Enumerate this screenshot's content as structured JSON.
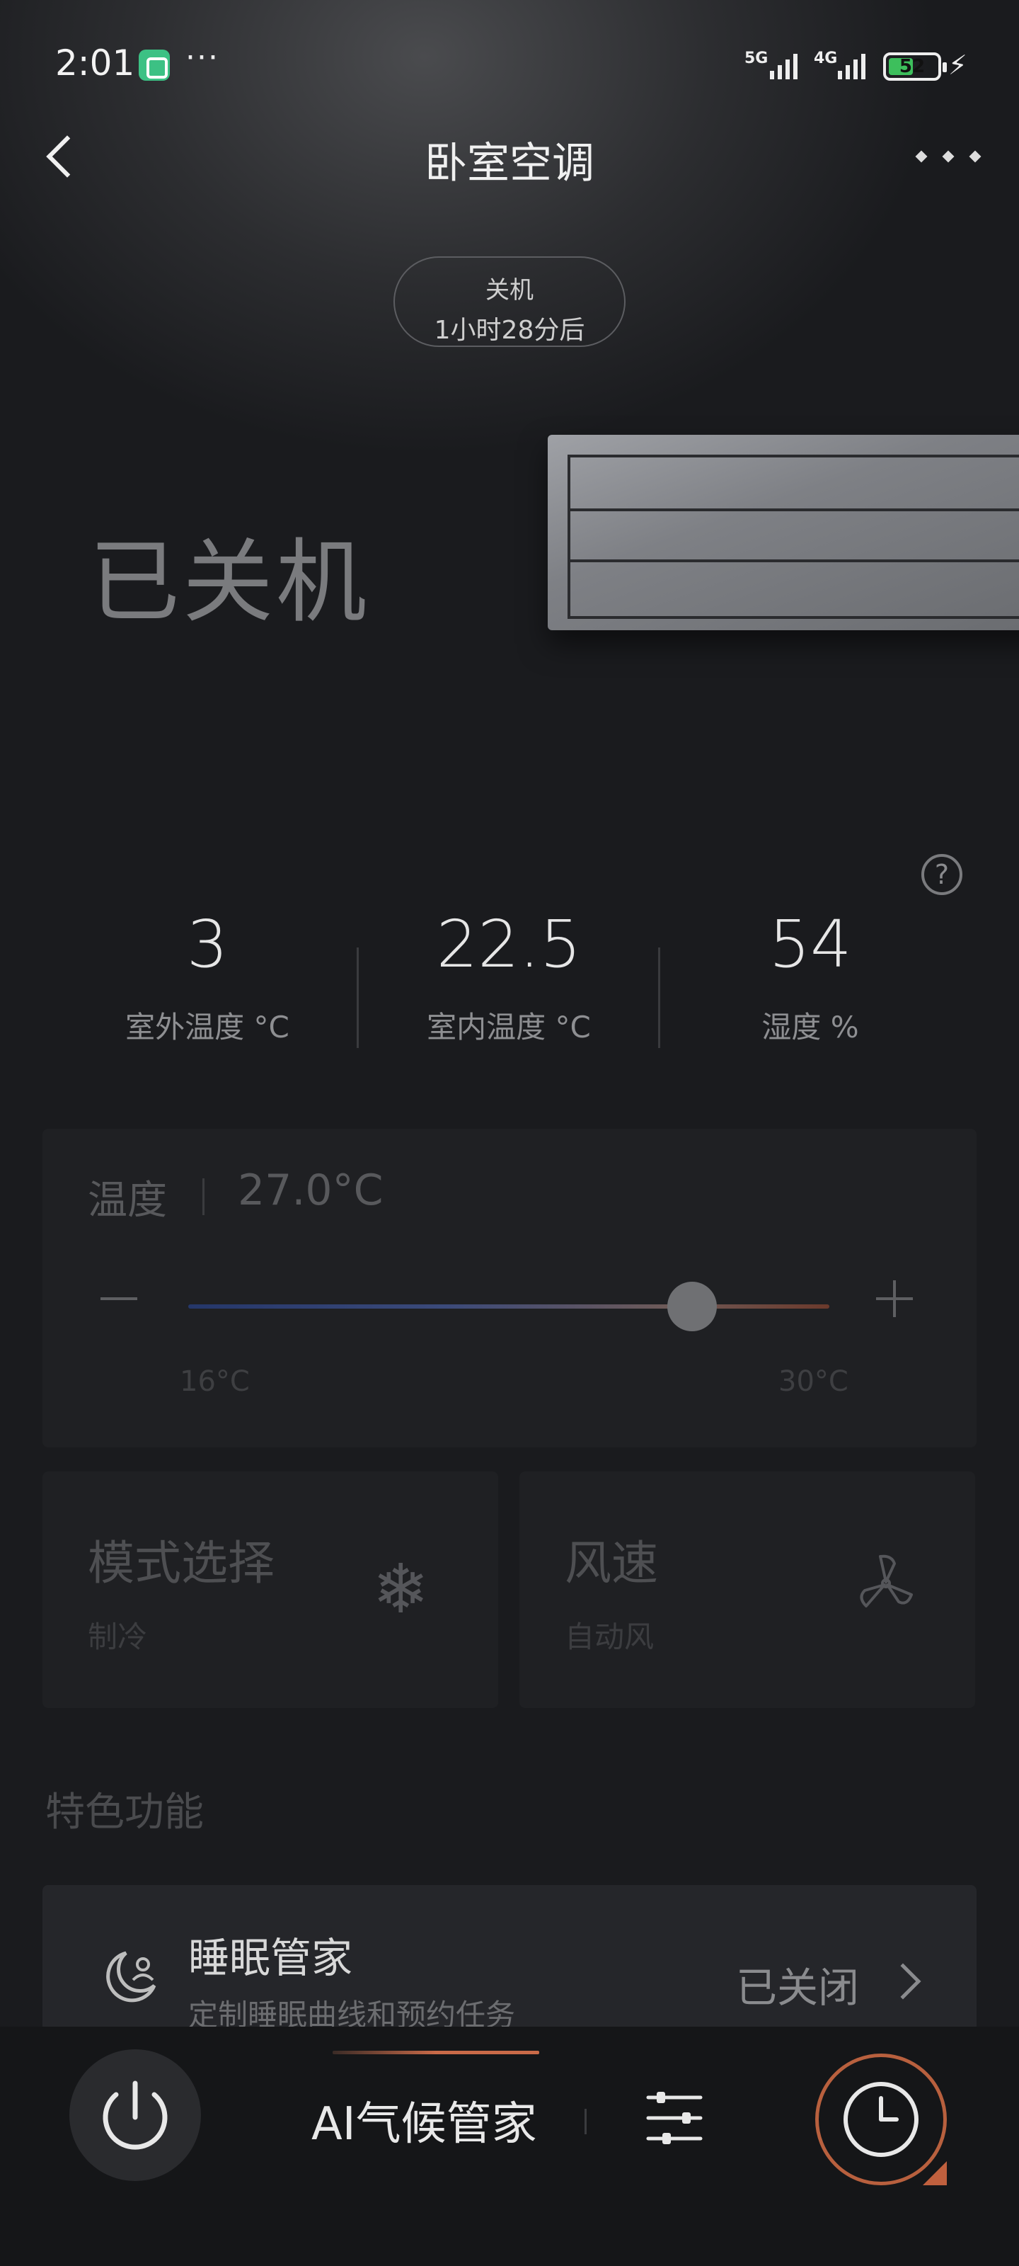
{
  "status_bar": {
    "time": "2:01",
    "signal_1": "5G",
    "signal_2": "4G",
    "battery_level": "52",
    "battery_fraction": 0.52
  },
  "header": {
    "title": "卧室空调"
  },
  "timer_pill": {
    "line1": "关机",
    "line2": "1小时28分后"
  },
  "hero": {
    "power_state": "已关机"
  },
  "stats": [
    {
      "value": "3",
      "label": "室外温度 °C"
    },
    {
      "value": "22.5",
      "label": "室内温度 °C"
    },
    {
      "value": "54",
      "label": "湿度 %"
    }
  ],
  "temperature": {
    "label": "温度",
    "value": "27.0°C",
    "min_label": "16°C",
    "max_label": "30°C",
    "min": 16,
    "max": 30,
    "current": 27.0
  },
  "mode": {
    "title": "模式选择",
    "value": "制冷",
    "icon": "snowflake-icon"
  },
  "fan": {
    "title": "风速",
    "value": "自动风",
    "icon": "fan-icon"
  },
  "features": {
    "section_title": "特色功能",
    "sleep": {
      "title": "睡眠管家",
      "description": "定制睡眠曲线和预约任务",
      "status": "已关闭"
    }
  },
  "bottom_bar": {
    "ai_label": "AI气候管家"
  },
  "colors": {
    "accent": "#c0603e",
    "slider_cold": "#25376a",
    "slider_warm": "#6b3a2c",
    "battery": "#3dbf5c"
  }
}
